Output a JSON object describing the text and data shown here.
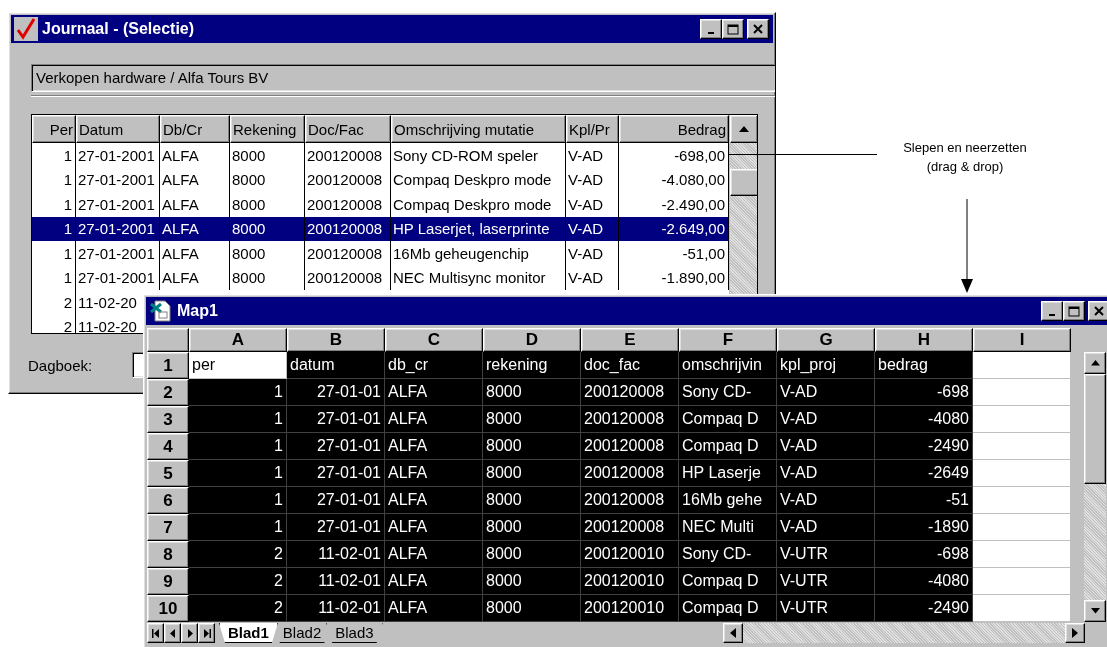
{
  "journaal_window": {
    "title": "Journaal - (Selectie)",
    "context": "Verkopen hardware / Alfa Tours BV",
    "columns": [
      "Per",
      "Datum",
      "Db/Cr",
      "Rekening",
      "Doc/Fac",
      "Omschrijving mutatie",
      "Kpl/Pr",
      "Bedrag"
    ],
    "rows": [
      {
        "selected": false,
        "cells": [
          "1",
          "27-01-2001",
          "ALFA",
          "8000",
          "200120008",
          "Sony CD-ROM speler",
          "V-AD",
          "-698,00"
        ]
      },
      {
        "selected": false,
        "cells": [
          "1",
          "27-01-2001",
          "ALFA",
          "8000",
          "200120008",
          "Compaq Deskpro mode",
          "V-AD",
          "-4.080,00"
        ]
      },
      {
        "selected": false,
        "cells": [
          "1",
          "27-01-2001",
          "ALFA",
          "8000",
          "200120008",
          "Compaq Deskpro mode",
          "V-AD",
          "-2.490,00"
        ]
      },
      {
        "selected": true,
        "cells": [
          "1",
          "27-01-2001",
          "ALFA",
          "8000",
          "200120008",
          "HP Laserjet, laserprinte",
          "V-AD",
          "-2.649,00"
        ]
      },
      {
        "selected": false,
        "cells": [
          "1",
          "27-01-2001",
          "ALFA",
          "8000",
          "200120008",
          "16Mb geheugenchip",
          "V-AD",
          "-51,00"
        ]
      },
      {
        "selected": false,
        "cells": [
          "1",
          "27-01-2001",
          "ALFA",
          "8000",
          "200120008",
          "NEC Multisync monitor",
          "V-AD",
          "-1.890,00"
        ]
      },
      {
        "selected": false,
        "cells": [
          "2",
          "11-02-20"
        ]
      },
      {
        "selected": false,
        "cells": [
          "2",
          "11-02-20"
        ]
      }
    ],
    "dagboek": {
      "label": "Dagboek:"
    }
  },
  "annotation": {
    "lines": [
      "Slepen en neerzetten",
      "(drag & drop)"
    ]
  },
  "map_window": {
    "title": "Map1",
    "columns": [
      "A",
      "B",
      "C",
      "D",
      "E",
      "F",
      "G",
      "H",
      "I"
    ],
    "rows": [
      {
        "header": "1",
        "selected": true,
        "cursor_in_first_cell": true,
        "cells": [
          "per",
          "datum",
          "db_cr",
          "rekening",
          "doc_fac",
          "omschrijvin",
          "kpl_proj",
          "bedrag"
        ]
      },
      {
        "header": "2",
        "selected": true,
        "cursor_in_first_cell": false,
        "cells": [
          "1",
          "27-01-01",
          "ALFA",
          "8000",
          "200120008",
          "Sony CD-",
          "V-AD",
          "-698"
        ]
      },
      {
        "header": "3",
        "selected": true,
        "cursor_in_first_cell": false,
        "cells": [
          "1",
          "27-01-01",
          "ALFA",
          "8000",
          "200120008",
          "Compaq D",
          "V-AD",
          "-4080"
        ]
      },
      {
        "header": "4",
        "selected": true,
        "cursor_in_first_cell": false,
        "cells": [
          "1",
          "27-01-01",
          "ALFA",
          "8000",
          "200120008",
          "Compaq D",
          "V-AD",
          "-2490"
        ]
      },
      {
        "header": "5",
        "selected": true,
        "cursor_in_first_cell": false,
        "cells": [
          "1",
          "27-01-01",
          "ALFA",
          "8000",
          "200120008",
          "HP Laserje",
          "V-AD",
          "-2649"
        ]
      },
      {
        "header": "6",
        "selected": true,
        "cursor_in_first_cell": false,
        "cells": [
          "1",
          "27-01-01",
          "ALFA",
          "8000",
          "200120008",
          "16Mb gehe",
          "V-AD",
          "-51"
        ]
      },
      {
        "header": "7",
        "selected": true,
        "cursor_in_first_cell": false,
        "cells": [
          "1",
          "27-01-01",
          "ALFA",
          "8000",
          "200120008",
          "NEC Multi",
          "V-AD",
          "-1890"
        ]
      },
      {
        "header": "8",
        "selected": true,
        "cursor_in_first_cell": false,
        "cells": [
          "2",
          "11-02-01",
          "ALFA",
          "8000",
          "200120010",
          "Sony CD-",
          "V-UTR",
          "-698"
        ]
      },
      {
        "header": "9",
        "selected": true,
        "cursor_in_first_cell": false,
        "cells": [
          "2",
          "11-02-01",
          "ALFA",
          "8000",
          "200120010",
          "Compaq D",
          "V-UTR",
          "-4080"
        ]
      },
      {
        "header": "10",
        "selected": true,
        "cursor_in_first_cell": false,
        "cells": [
          "2",
          "11-02-01",
          "ALFA",
          "8000",
          "200120010",
          "Compaq D",
          "V-UTR",
          "-2490"
        ]
      }
    ],
    "sheet_tabs": [
      {
        "label": "Blad1",
        "selected": true
      },
      {
        "label": "Blad2",
        "selected": false
      },
      {
        "label": "Blad3",
        "selected": false
      }
    ]
  }
}
